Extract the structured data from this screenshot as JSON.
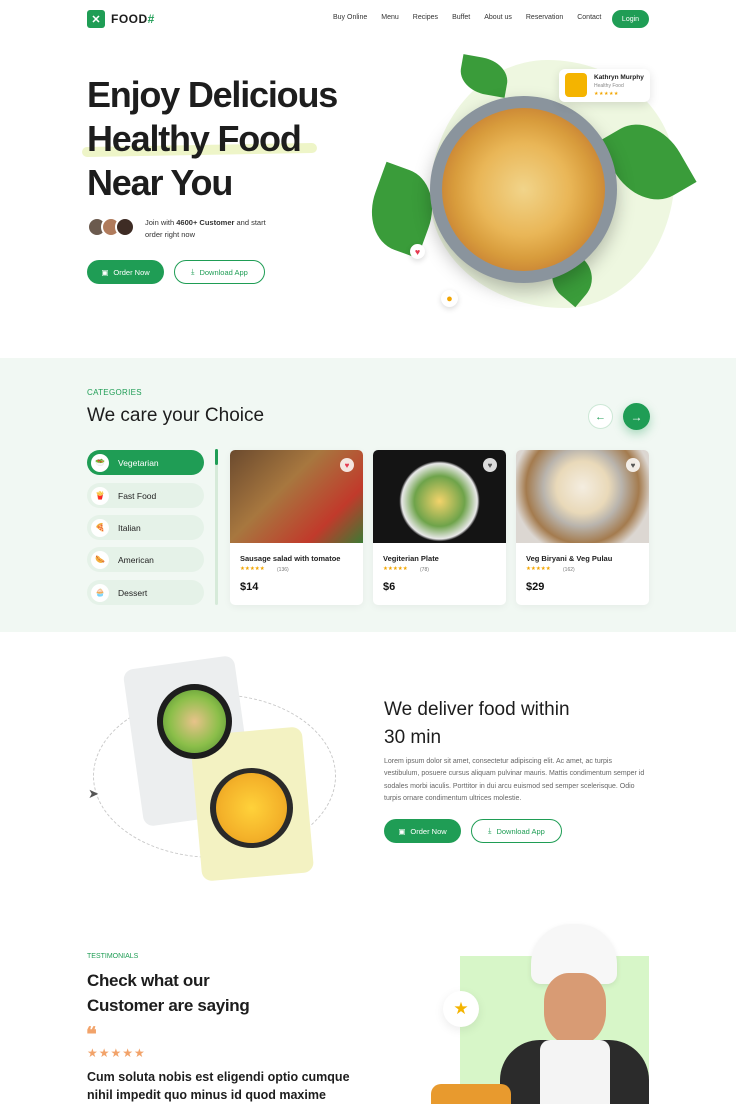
{
  "nav": {
    "logo_icon": "fork-knife-icon",
    "logo_text": "FOOD",
    "logo_suffix": "#",
    "links": [
      "Buy Online",
      "Menu",
      "Recipes",
      "Buffet",
      "About us",
      "Reservation",
      "Contact"
    ],
    "login": "Login"
  },
  "hero": {
    "line1": "Enjoy Delicious",
    "line2": "Healthy Food",
    "line3": "Near You",
    "join_pre": "Join with ",
    "join_count": "4600+ Customer",
    "join_post": " and start order right now",
    "order_btn": "Order Now",
    "download_btn": "Download App",
    "review_name": "Kathryn Murphy",
    "review_sub": "Healthy Food",
    "review_stars": "★★★★★"
  },
  "categories": {
    "kicker": "CATEGORIES",
    "title": "We care your Choice",
    "items": [
      "Vegetarian",
      "Fast Food",
      "Italian",
      "American",
      "Dessert"
    ],
    "foods": [
      {
        "name": "Sausage salad with tomatoe",
        "stars": "★★★★★",
        "count": "(136)",
        "price": "$14"
      },
      {
        "name": "Vegiterian Plate",
        "stars": "★★★★★",
        "count": "(78)",
        "price": "$6"
      },
      {
        "name": "Veg Biryani & Veg Pulau",
        "stars": "★★★★★",
        "count": "(162)",
        "price": "$29"
      }
    ]
  },
  "delivery": {
    "title1": "We deliver food within",
    "title2": "30 min",
    "body": "Lorem ipsum dolor sit amet, consectetur adipiscing elit. Ac amet, ac turpis vestibulum, posuere cursus aliquam pulvinar mauris. Mattis condimentum semper id sodales morbi iaculis. Porttitor in dui arcu euismod sed semper scelerisque. Odio turpis ornare condimentum ultrices molestie.",
    "order_btn": "Order Now",
    "download_btn": "Download App"
  },
  "testimonials": {
    "kicker": "TESTIMONIALS",
    "title1": "Check what our",
    "title2": "Customer are saying",
    "quote_mark": "❝",
    "stars": "★★★★★",
    "text": "Cum soluta nobis est eligendi optio cumque nihil impedit quo minus id quod maxime placeat"
  },
  "colors": {
    "brand": "#1f9d55",
    "accent_star": "#f2a36a"
  }
}
